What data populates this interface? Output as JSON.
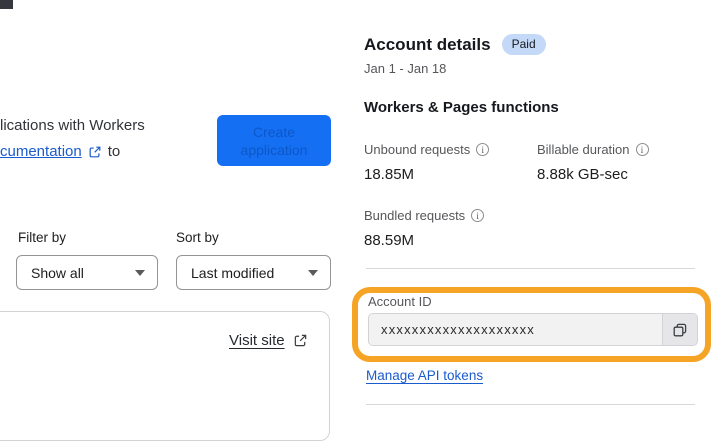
{
  "left": {
    "intro_line1": "lications with Workers",
    "intro_link_text": "cumentation",
    "intro_line2_suffix": "to",
    "create_button_label": "Create application",
    "filter_label": "Filter by",
    "filter_value": "Show all",
    "sort_label": "Sort by",
    "sort_value": "Last modified",
    "visit_site_label": "Visit site"
  },
  "account": {
    "title": "Account details",
    "badge": "Paid",
    "date_range": "Jan 1 - Jan 18",
    "section_title": "Workers & Pages functions",
    "stats": [
      {
        "label": "Unbound requests",
        "value": "18.85M"
      },
      {
        "label": "Billable duration",
        "value": "8.88k GB-sec"
      },
      {
        "label": "Bundled requests",
        "value": "88.59M"
      }
    ],
    "account_id_label": "Account ID",
    "account_id_value": "xxxxxxxxxxxxxxxxxxxx",
    "manage_link_label": "Manage API tokens"
  },
  "icons": {
    "external_link": "external-link-icon",
    "copy": "copy-icon",
    "info": "info-icon",
    "chevron": "chevron-down-icon"
  },
  "colors": {
    "accent_blue": "#156ff2",
    "button_text_blue": "#0d57c9",
    "highlight_orange": "#f5a426",
    "badge_bg": "#c4d8f8",
    "link_blue": "#1a5bce",
    "label_gray": "#56575a"
  }
}
